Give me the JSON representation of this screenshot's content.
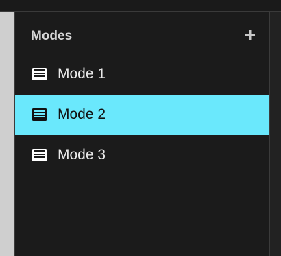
{
  "panel": {
    "title": "Modes",
    "add_icon": "plus-icon"
  },
  "modes": [
    {
      "label": "Mode 1",
      "icon": "table-icon",
      "selected": false
    },
    {
      "label": "Mode 2",
      "icon": "table-icon",
      "selected": true
    },
    {
      "label": "Mode 3",
      "icon": "table-icon",
      "selected": false
    }
  ],
  "colors": {
    "panel_bg": "#1b1b1b",
    "selected_bg": "#6ae8fc",
    "text": "#eaeaea",
    "header_text": "#d6d6d6"
  }
}
